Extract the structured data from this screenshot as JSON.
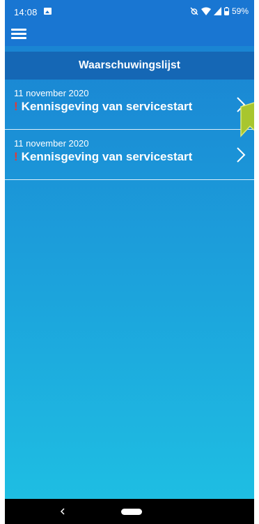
{
  "status_bar": {
    "time": "14:08",
    "battery": "59%",
    "icons": [
      "gallery-icon",
      "alarm-off-icon",
      "wifi-icon",
      "signal-icon",
      "battery-icon"
    ]
  },
  "app_bar": {
    "menu_icon": "hamburger-menu-icon"
  },
  "header": {
    "title": "Waarschuwingslijst"
  },
  "alerts": [
    {
      "date": "11 november 2020",
      "marker": "!",
      "title": "Kennisgeving van servicestart"
    },
    {
      "date": "11 november 2020",
      "marker": "!",
      "title": "Kennisgeving van servicestart"
    }
  ],
  "colors": {
    "app_bar": "#1976d2",
    "header": "#1567b5",
    "gradient_top": "#1a7fd1",
    "gradient_bottom": "#1fc1e3",
    "alert_marker": "#e53935",
    "tooltip_flag": "#a8c62e"
  },
  "nav_bar": {
    "icons": [
      "back-icon",
      "home-pill-icon"
    ]
  }
}
